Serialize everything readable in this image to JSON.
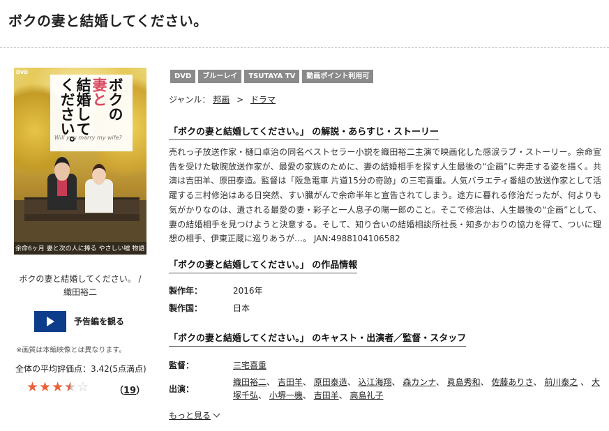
{
  "page": {
    "title": "ボクの妻と結婚してください。"
  },
  "cover": {
    "title_columns": [
      "ボクの",
      "妻と",
      "結婚して",
      "ください。"
    ],
    "subtitle": "Will you marry my wife?",
    "dvd_mark": "DVD",
    "bottom_text": "余命6ヶ月 妻と次の人に捧る やさしい嘘 物語"
  },
  "caption": {
    "line1": "ボクの妻と結婚してください。 /",
    "line2": "織田裕二"
  },
  "trailer": {
    "label": "予告編を観る"
  },
  "note": "※画質は本編映像とは異なります。",
  "rating": {
    "text": "全体の平均評価点：3.42(5点満点)",
    "value": 3.42,
    "max": 5,
    "count": "19"
  },
  "badges": [
    "DVD",
    "ブルーレイ",
    "TSUTAYA TV",
    "動画ポイント利用可"
  ],
  "genre": {
    "label": "ジャンル：",
    "path": [
      "邦画",
      "ドラマ"
    ],
    "separator": ">"
  },
  "synopsis": {
    "heading": "「ボクの妻と結婚してください。」 の解説・あらすじ・ストーリー",
    "body": "売れっ子放送作家・樋口卓治の同名ベストセラー小説を織田裕二主演で映画化した感涙ラブ・ストーリー。余命宣告を受けた敏腕放送作家が、最愛の家族のために、妻の結婚相手を探す人生最後の“企画”に奔走する姿を描く。共演は吉田羊、原田泰造。監督は「阪急電車 片道15分の奇跡」の三宅喜重。人気バラエティ番組の放送作家として活躍する三村修治はある日突然、すい臓がんで余命半年と宣告されてしまう。途方に暮れる修治だったが、何よりも気がかりなのは、遺される最愛の妻・彩子と一人息子の陽一郎のこと。そこで修治は、人生最後の“企画”として、妻の結婚相手を見つけようと決意する。そして、知り合いの結婚相談所社長・知多かおりの協力を得て、ついに理想の相手、伊東正蔵に巡りあうが…。 JAN:4988104106582"
  },
  "info": {
    "heading": "「ボクの妻と結婚してください。」 の作品情報",
    "year_label": "製作年：",
    "year": "2016年",
    "country_label": "製作国：",
    "country": "日本"
  },
  "cast": {
    "heading": "「ボクの妻と結婚してください。」 のキャスト・出演者／監督・スタッフ",
    "director_label": "監督：",
    "director": "三宅喜重",
    "cast_label": "出演：",
    "members": [
      "織田裕二",
      "吉田羊",
      "原田泰造",
      "込江海翔",
      "森カンナ",
      "眞島秀和",
      "佐藤ありさ",
      "前川泰之",
      "大塚千弘",
      "小堺一機",
      "吉田羊",
      "高島礼子"
    ],
    "more_label": "もっと見る"
  }
}
